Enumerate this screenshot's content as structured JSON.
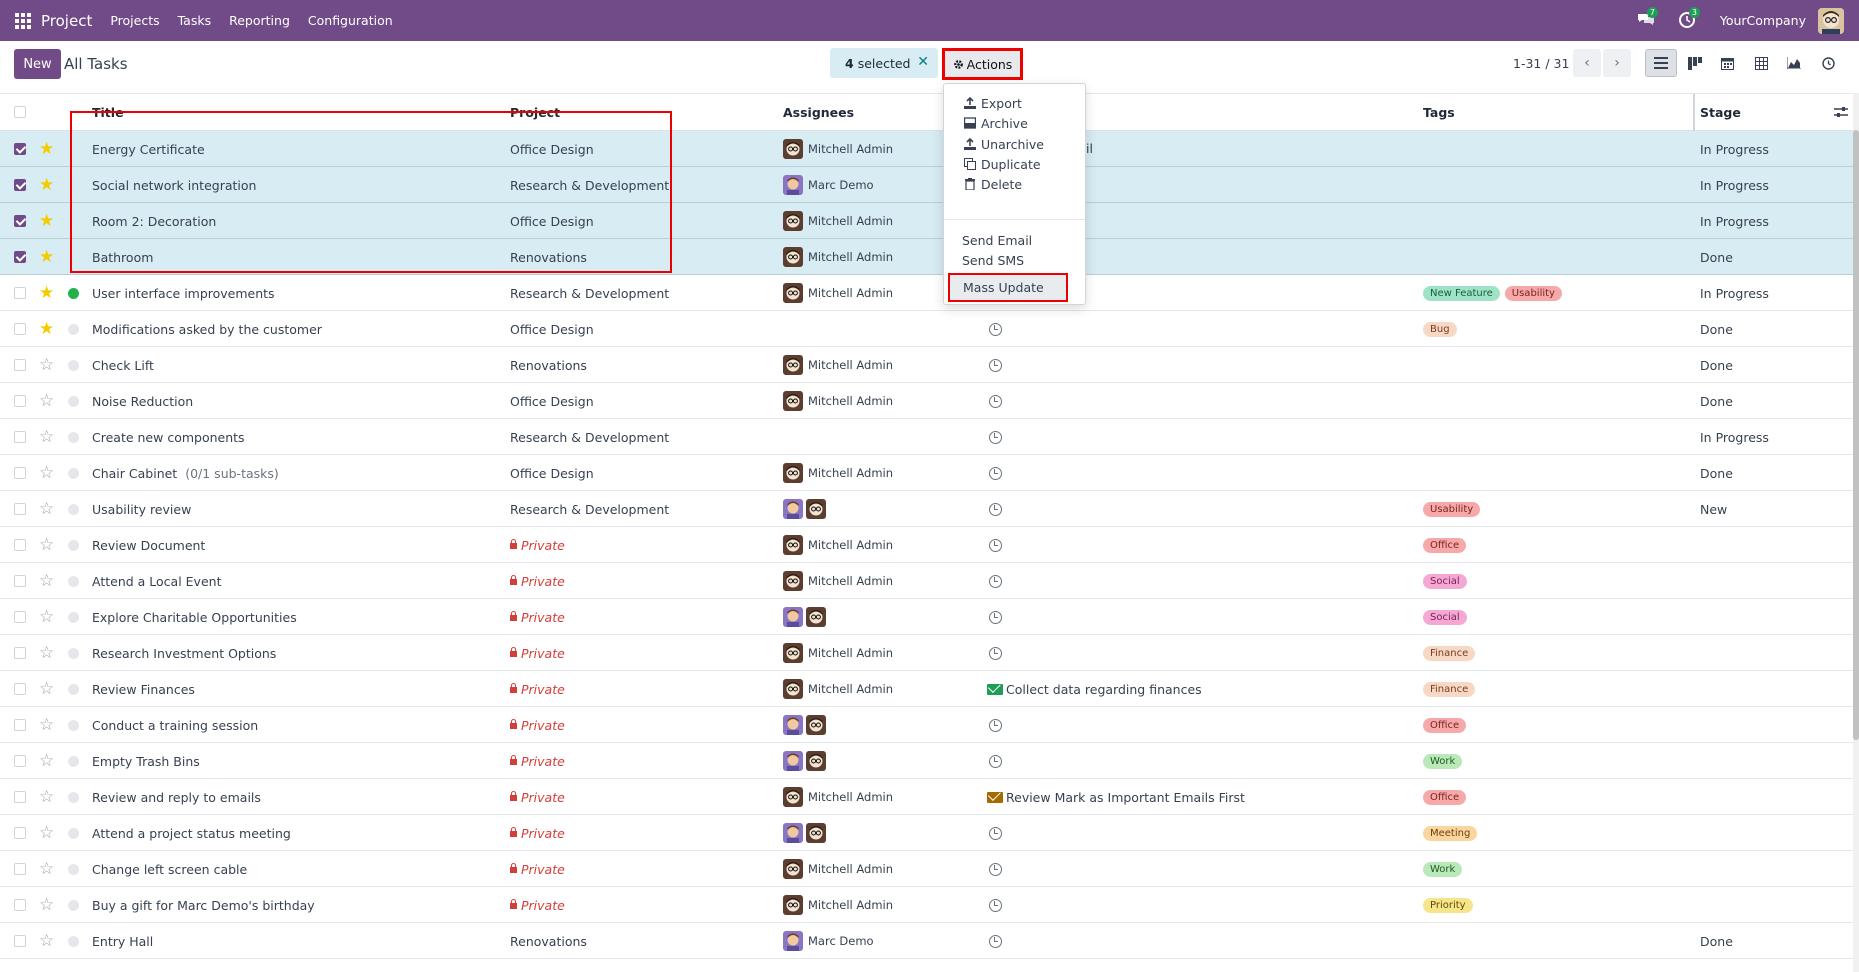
{
  "navbar": {
    "app_title": "Project",
    "menu": [
      "Projects",
      "Tasks",
      "Reporting",
      "Configuration"
    ],
    "messages_count": "7",
    "activities_count": "3",
    "company": "YourCompany"
  },
  "control": {
    "new_label": "New",
    "breadcrumb": "All Tasks",
    "selected_count": "4",
    "selected_suffix": "selected",
    "actions_label": "Actions",
    "pager": "1-31 / 31"
  },
  "columns": {
    "title": "Title",
    "project": "Project",
    "assignees": "Assignees",
    "tags": "Tags",
    "stage": "Stage"
  },
  "actions_menu": {
    "export": "Export",
    "archive": "Archive",
    "unarchive": "Unarchive",
    "duplicate": "Duplicate",
    "delete": "Delete",
    "send_email": "Send Email",
    "send_sms": "Send SMS",
    "mass_update": "Mass Update"
  },
  "partial_activity_text": "il",
  "rows": [
    {
      "title": "Energy Certificate",
      "sub": "",
      "project": "Office Design",
      "private": false,
      "assignees": [
        "admin"
      ],
      "assignee_name": "Mitchell Admin",
      "activity": "none",
      "activity_text": "",
      "tags": [],
      "stage": "In Progress",
      "selected": true,
      "starred": true,
      "status": "none"
    },
    {
      "title": "Social network integration",
      "sub": "",
      "project": "Research & Development",
      "private": false,
      "assignees": [
        "marc"
      ],
      "assignee_name": "Marc Demo",
      "activity": "none",
      "activity_text": "",
      "tags": [],
      "stage": "In Progress",
      "selected": true,
      "starred": true,
      "status": "none"
    },
    {
      "title": "Room 2: Decoration",
      "sub": "",
      "project": "Office Design",
      "private": false,
      "assignees": [
        "admin"
      ],
      "assignee_name": "Mitchell Admin",
      "activity": "none",
      "activity_text": "",
      "tags": [],
      "stage": "In Progress",
      "selected": true,
      "starred": true,
      "status": "none"
    },
    {
      "title": "Bathroom",
      "sub": "",
      "project": "Renovations",
      "private": false,
      "assignees": [
        "admin"
      ],
      "assignee_name": "Mitchell Admin",
      "activity": "none",
      "activity_text": "",
      "tags": [],
      "stage": "Done",
      "selected": true,
      "starred": true,
      "status": "none"
    },
    {
      "title": "User interface improvements",
      "sub": "",
      "project": "Research & Development",
      "private": false,
      "assignees": [
        "admin"
      ],
      "assignee_name": "Mitchell Admin",
      "activity": "none",
      "activity_text": "",
      "tags": [
        {
          "label": "New Feature",
          "bg": "#9ee3c5",
          "fg": "#1d5c3f"
        },
        {
          "label": "Usability",
          "bg": "#f7a9a9",
          "fg": "#7a1f1f"
        }
      ],
      "stage": "In Progress",
      "selected": false,
      "starred": true,
      "status": "green"
    },
    {
      "title": "Modifications asked by the customer",
      "sub": "",
      "project": "Office Design",
      "private": false,
      "assignees": [],
      "assignee_name": "",
      "activity": "clock",
      "activity_text": "",
      "tags": [
        {
          "label": "Bug",
          "bg": "#f6d8c5",
          "fg": "#7a3d1f"
        }
      ],
      "stage": "Done",
      "selected": false,
      "starred": true,
      "status": "grey"
    },
    {
      "title": "Check Lift",
      "sub": "",
      "project": "Renovations",
      "private": false,
      "assignees": [
        "admin"
      ],
      "assignee_name": "Mitchell Admin",
      "activity": "clock",
      "activity_text": "",
      "tags": [],
      "stage": "Done",
      "selected": false,
      "starred": false,
      "status": "grey"
    },
    {
      "title": "Noise Reduction",
      "sub": "",
      "project": "Office Design",
      "private": false,
      "assignees": [
        "admin"
      ],
      "assignee_name": "Mitchell Admin",
      "activity": "clock",
      "activity_text": "",
      "tags": [],
      "stage": "Done",
      "selected": false,
      "starred": false,
      "status": "grey"
    },
    {
      "title": "Create new components",
      "sub": "",
      "project": "Research & Development",
      "private": false,
      "assignees": [],
      "assignee_name": "",
      "activity": "clock",
      "activity_text": "",
      "tags": [],
      "stage": "In Progress",
      "selected": false,
      "starred": false,
      "status": "grey"
    },
    {
      "title": "Chair Cabinet",
      "sub": "(0/1 sub-tasks)",
      "project": "Office Design",
      "private": false,
      "assignees": [
        "admin"
      ],
      "assignee_name": "Mitchell Admin",
      "activity": "clock",
      "activity_text": "",
      "tags": [],
      "stage": "Done",
      "selected": false,
      "starred": false,
      "status": "grey"
    },
    {
      "title": "Usability review",
      "sub": "",
      "project": "Research & Development",
      "private": false,
      "assignees": [
        "marc",
        "admin"
      ],
      "assignee_name": "",
      "activity": "clock",
      "activity_text": "",
      "tags": [
        {
          "label": "Usability",
          "bg": "#f7a9a9",
          "fg": "#7a1f1f"
        }
      ],
      "stage": "New",
      "selected": false,
      "starred": false,
      "status": "grey"
    },
    {
      "title": "Review Document",
      "sub": "",
      "project": "Private",
      "private": true,
      "assignees": [
        "admin"
      ],
      "assignee_name": "Mitchell Admin",
      "activity": "clock",
      "activity_text": "",
      "tags": [
        {
          "label": "Office",
          "bg": "#f7a9a9",
          "fg": "#7a1f1f"
        }
      ],
      "stage": "",
      "selected": false,
      "starred": false,
      "status": "grey"
    },
    {
      "title": "Attend a Local Event",
      "sub": "",
      "project": "Private",
      "private": true,
      "assignees": [
        "admin"
      ],
      "assignee_name": "Mitchell Admin",
      "activity": "clock",
      "activity_text": "",
      "tags": [
        {
          "label": "Social",
          "bg": "#f5a8d4",
          "fg": "#7a1f55"
        }
      ],
      "stage": "",
      "selected": false,
      "starred": false,
      "status": "grey"
    },
    {
      "title": "Explore Charitable Opportunities",
      "sub": "",
      "project": "Private",
      "private": true,
      "assignees": [
        "marc",
        "admin"
      ],
      "assignee_name": "",
      "activity": "clock",
      "activity_text": "",
      "tags": [
        {
          "label": "Social",
          "bg": "#f5a8d4",
          "fg": "#7a1f55"
        }
      ],
      "stage": "",
      "selected": false,
      "starred": false,
      "status": "grey"
    },
    {
      "title": "Research Investment Options",
      "sub": "",
      "project": "Private",
      "private": true,
      "assignees": [
        "admin"
      ],
      "assignee_name": "Mitchell Admin",
      "activity": "clock",
      "activity_text": "",
      "tags": [
        {
          "label": "Finance",
          "bg": "#f6d8c5",
          "fg": "#7a3d1f"
        }
      ],
      "stage": "",
      "selected": false,
      "starred": false,
      "status": "grey"
    },
    {
      "title": "Review Finances",
      "sub": "",
      "project": "Private",
      "private": true,
      "assignees": [
        "admin"
      ],
      "assignee_name": "Mitchell Admin",
      "activity": "mail-green",
      "activity_text": "Collect data regarding finances",
      "tags": [
        {
          "label": "Finance",
          "bg": "#f6d8c5",
          "fg": "#7a3d1f"
        }
      ],
      "stage": "",
      "selected": false,
      "starred": false,
      "status": "grey"
    },
    {
      "title": "Conduct a training session",
      "sub": "",
      "project": "Private",
      "private": true,
      "assignees": [
        "marc",
        "admin"
      ],
      "assignee_name": "",
      "activity": "clock",
      "activity_text": "",
      "tags": [
        {
          "label": "Office",
          "bg": "#f7a9a9",
          "fg": "#7a1f1f"
        }
      ],
      "stage": "",
      "selected": false,
      "starred": false,
      "status": "grey"
    },
    {
      "title": "Empty Trash Bins",
      "sub": "",
      "project": "Private",
      "private": true,
      "assignees": [
        "marc",
        "admin"
      ],
      "assignee_name": "",
      "activity": "clock",
      "activity_text": "",
      "tags": [
        {
          "label": "Work",
          "bg": "#b9e8b9",
          "fg": "#1f5c1f"
        }
      ],
      "stage": "",
      "selected": false,
      "starred": false,
      "status": "grey"
    },
    {
      "title": "Review and reply to emails",
      "sub": "",
      "project": "Private",
      "private": true,
      "assignees": [
        "admin"
      ],
      "assignee_name": "Mitchell Admin",
      "activity": "mail-amber",
      "activity_text": "Review Mark as Important Emails First",
      "tags": [
        {
          "label": "Office",
          "bg": "#f7a9a9",
          "fg": "#7a1f1f"
        }
      ],
      "stage": "",
      "selected": false,
      "starred": false,
      "status": "grey"
    },
    {
      "title": "Attend a project status meeting",
      "sub": "",
      "project": "Private",
      "private": true,
      "assignees": [
        "marc",
        "admin"
      ],
      "assignee_name": "",
      "activity": "clock",
      "activity_text": "",
      "tags": [
        {
          "label": "Meeting",
          "bg": "#fbd49e",
          "fg": "#6b4210"
        }
      ],
      "stage": "",
      "selected": false,
      "starred": false,
      "status": "grey"
    },
    {
      "title": "Change left screen cable",
      "sub": "",
      "project": "Private",
      "private": true,
      "assignees": [
        "admin"
      ],
      "assignee_name": "Mitchell Admin",
      "activity": "clock",
      "activity_text": "",
      "tags": [
        {
          "label": "Work",
          "bg": "#b9e8b9",
          "fg": "#1f5c1f"
        }
      ],
      "stage": "",
      "selected": false,
      "starred": false,
      "status": "grey"
    },
    {
      "title": "Buy a gift for Marc Demo's birthday",
      "sub": "",
      "project": "Private",
      "private": true,
      "assignees": [
        "admin"
      ],
      "assignee_name": "Mitchell Admin",
      "activity": "clock",
      "activity_text": "",
      "tags": [
        {
          "label": "Priority",
          "bg": "#f7e58a",
          "fg": "#5c4d0a"
        }
      ],
      "stage": "",
      "selected": false,
      "starred": false,
      "status": "grey"
    },
    {
      "title": "Entry Hall",
      "sub": "",
      "project": "Renovations",
      "private": false,
      "assignees": [
        "marc"
      ],
      "assignee_name": "Marc Demo",
      "activity": "clock",
      "activity_text": "",
      "tags": [],
      "stage": "Done",
      "selected": false,
      "starred": false,
      "status": "grey"
    }
  ]
}
